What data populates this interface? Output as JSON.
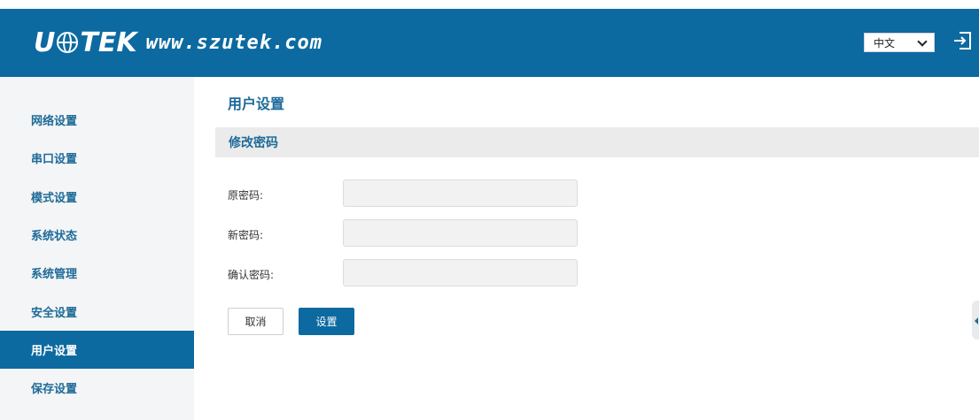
{
  "header": {
    "logo_brand": "UOTEK",
    "logo_site": "www.szutek.com",
    "language": "中文"
  },
  "sidebar": {
    "items": [
      {
        "label": "网络设置"
      },
      {
        "label": "串口设置"
      },
      {
        "label": "模式设置"
      },
      {
        "label": "系统状态"
      },
      {
        "label": "系统管理"
      },
      {
        "label": "安全设置"
      },
      {
        "label": "用户设置"
      },
      {
        "label": "保存设置"
      }
    ],
    "active": "用户设置"
  },
  "main": {
    "page_title": "用户设置",
    "section_title": "修改密码",
    "fields": [
      {
        "label": "原密码:",
        "value": ""
      },
      {
        "label": "新密码:",
        "value": ""
      },
      {
        "label": "确认密码:",
        "value": ""
      }
    ],
    "cancel_label": "取消",
    "save_label": "设置"
  },
  "colors": {
    "brand": "#0c6aa0",
    "accent_text": "#1d6a98",
    "section_bg": "#ebebeb"
  },
  "icons": {
    "logout": "logout-icon",
    "language_dropdown": "chevron-down-icon"
  }
}
